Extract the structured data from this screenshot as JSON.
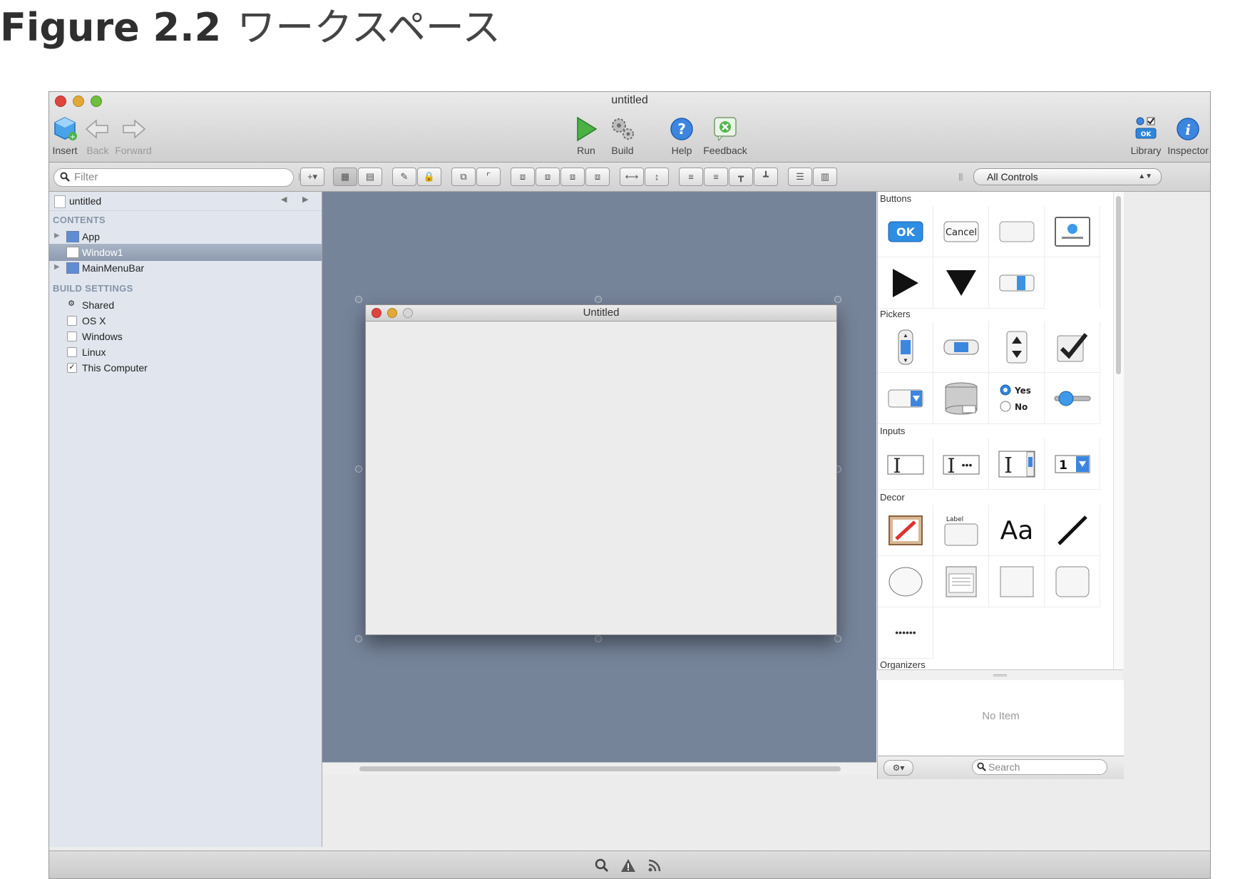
{
  "caption": {
    "figure": "Figure 2.2",
    "subtitle": "ワークスペース"
  },
  "window": {
    "title": "untitled"
  },
  "toolbar": {
    "insert": "Insert",
    "back": "Back",
    "forward": "Forward",
    "run": "Run",
    "build": "Build",
    "help": "Help",
    "feedback": "Feedback",
    "library": "Library",
    "inspector": "Inspector"
  },
  "filter": {
    "placeholder": "Filter"
  },
  "controls_popup": {
    "value": "All Controls"
  },
  "sidebar": {
    "document": "untitled",
    "contents_header": "CONTENTS",
    "contents": [
      {
        "label": "App"
      },
      {
        "label": "Window1"
      },
      {
        "label": "MainMenuBar"
      }
    ],
    "build_header": "BUILD SETTINGS",
    "build": [
      {
        "label": "Shared"
      },
      {
        "label": "OS X"
      },
      {
        "label": "Windows"
      },
      {
        "label": "Linux"
      },
      {
        "label": "This Computer",
        "checked_mark": "✓"
      }
    ]
  },
  "designer": {
    "window_title": "Untitled"
  },
  "library": {
    "sections": [
      "Buttons",
      "Pickers",
      "Inputs",
      "Decor",
      "Organizers"
    ],
    "ok_label": "OK",
    "cancel_label": "Cancel",
    "yes_label": "Yes",
    "no_label": "No",
    "label_text": "Label",
    "font_sample": "Aa",
    "number_sample": "1"
  },
  "inspector": {
    "empty": "No Item"
  },
  "library_search": {
    "placeholder": "Search"
  }
}
